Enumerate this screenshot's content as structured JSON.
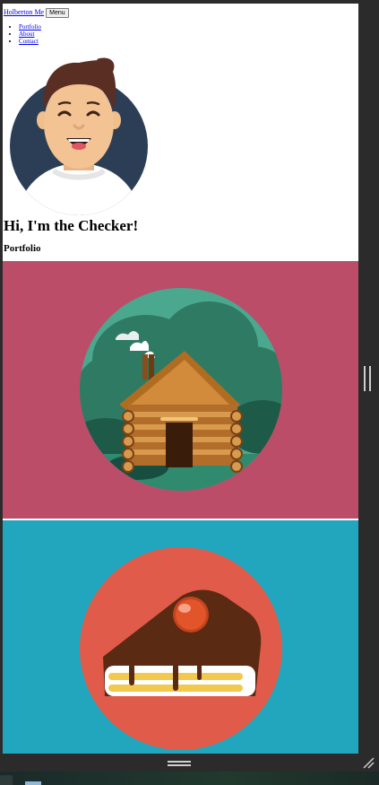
{
  "header": {
    "brand": "Holberton Me",
    "menu_label": "Menu"
  },
  "nav": {
    "items": [
      {
        "label": "Portfolio"
      },
      {
        "label": "About"
      },
      {
        "label": "Contact"
      }
    ]
  },
  "hero": {
    "headline": "Hi, I'm the Checker!"
  },
  "portfolio": {
    "title": "Portfolio",
    "items": [
      {
        "icon": "log-cabin-illustration",
        "background": "#bb4d68"
      },
      {
        "icon": "cake-slice-illustration",
        "background": "#22a6bd"
      }
    ]
  },
  "colors": {
    "link": "#0000ee",
    "dark_chrome": "#2b2b2b"
  }
}
